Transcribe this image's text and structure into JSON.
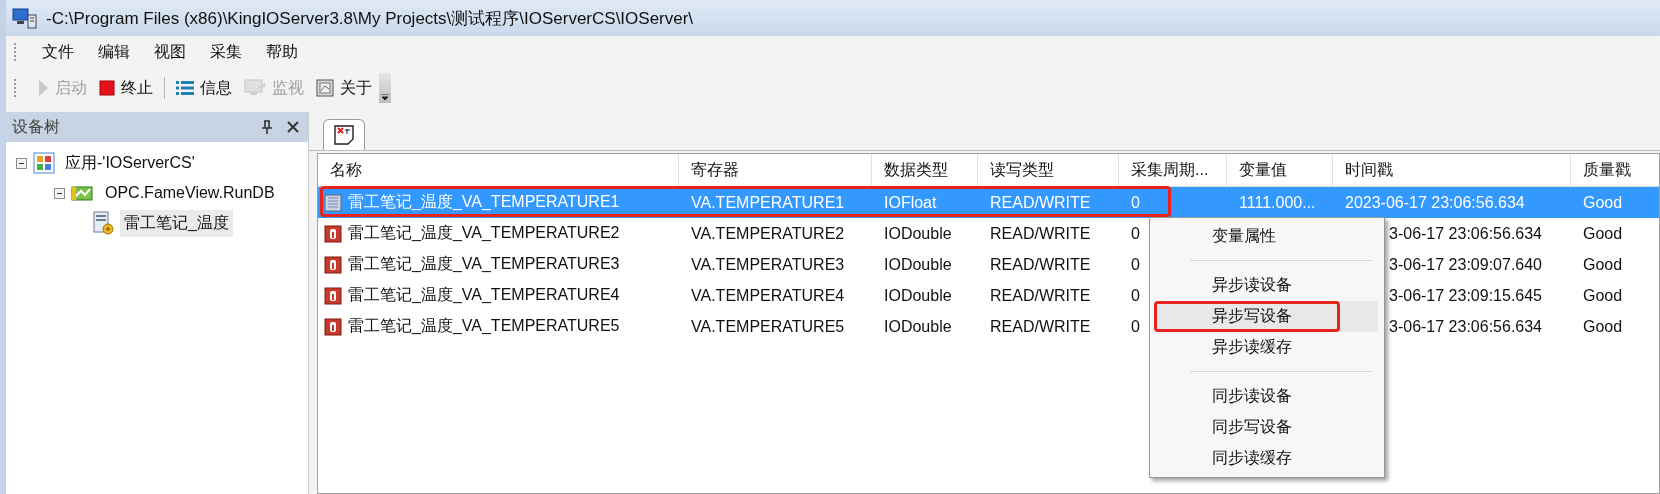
{
  "window": {
    "title": "-C:\\Program Files (x86)\\KingIOServer3.8\\My Projects\\测试程序\\IOServerCS\\IOServer\\"
  },
  "menu_bar": [
    "文件",
    "编辑",
    "视图",
    "采集",
    "帮助"
  ],
  "toolbar": [
    {
      "kind": "play",
      "label": "启动",
      "disabled": true
    },
    {
      "kind": "stop",
      "label": "终止",
      "disabled": false
    },
    {
      "kind": "separator"
    },
    {
      "kind": "list",
      "label": "信息",
      "disabled": false
    },
    {
      "kind": "monitor",
      "label": "监视",
      "disabled": true
    },
    {
      "kind": "about",
      "label": "关于",
      "disabled": false
    },
    {
      "kind": "overflow"
    }
  ],
  "device_tree": {
    "title": "设备树",
    "items": [
      {
        "label": "应用-'IOServerCS'",
        "kind": "app",
        "expanded": true,
        "selected": false,
        "children": [
          {
            "label": "OPC.FameView.RunDB",
            "kind": "driver",
            "expanded": true,
            "selected": false,
            "children": [
              {
                "label": "雷工笔记_温度",
                "kind": "device",
                "selected": true
              }
            ]
          }
        ]
      }
    ]
  },
  "table": {
    "columns": [
      "名称",
      "寄存器",
      "数据类型",
      "读写类型",
      "采集周期...",
      "变量值",
      "时间戳",
      "质量戳"
    ],
    "rows": [
      {
        "name": "雷工笔记_温度_VA_TEMPERATURE1",
        "register": "VA.TEMPERATURE1",
        "data_type": "IOFloat",
        "access": "READ/WRITE",
        "period": "0",
        "value": "1111.000...",
        "timestamp": "2023-06-17 23:06:56.634",
        "timestamp_covered": false,
        "quality": "Good",
        "selected": true,
        "annotated": true
      },
      {
        "name": "雷工笔记_温度_VA_TEMPERATURE2",
        "register": "VA.TEMPERATURE2",
        "data_type": "IODouble",
        "access": "READ/WRITE",
        "period": "0",
        "timestamp": "3-06-17 23:06:56.634",
        "timestamp_covered": true,
        "quality": "Good",
        "selected": false,
        "annotated": false
      },
      {
        "name": "雷工笔记_温度_VA_TEMPERATURE3",
        "register": "VA.TEMPERATURE3",
        "data_type": "IODouble",
        "access": "READ/WRITE",
        "period": "0",
        "timestamp": "3-06-17 23:09:07.640",
        "timestamp_covered": true,
        "quality": "Good",
        "selected": false,
        "annotated": false
      },
      {
        "name": "雷工笔记_温度_VA_TEMPERATURE4",
        "register": "VA.TEMPERATURE4",
        "data_type": "IODouble",
        "access": "READ/WRITE",
        "period": "0",
        "timestamp": "3-06-17 23:09:15.645",
        "timestamp_covered": true,
        "quality": "Good",
        "selected": false,
        "annotated": false
      },
      {
        "name": "雷工笔记_温度_VA_TEMPERATURE5",
        "register": "VA.TEMPERATURE5",
        "data_type": "IODouble",
        "access": "READ/WRITE",
        "period": "0",
        "timestamp": "3-06-17 23:06:56.634",
        "timestamp_covered": true,
        "quality": "Good",
        "selected": false,
        "annotated": false
      }
    ]
  },
  "context_menu": {
    "items": [
      {
        "kind": "item",
        "label": "变量属性",
        "highlighted": false,
        "annotated": false
      },
      {
        "kind": "separator"
      },
      {
        "kind": "item",
        "label": "异步读设备",
        "highlighted": false,
        "annotated": false
      },
      {
        "kind": "item",
        "label": "异步写设备",
        "highlighted": true,
        "annotated": true
      },
      {
        "kind": "item",
        "label": "异步读缓存",
        "highlighted": false,
        "annotated": false
      },
      {
        "kind": "separator"
      },
      {
        "kind": "item",
        "label": "同步读设备",
        "highlighted": false,
        "annotated": false
      },
      {
        "kind": "item",
        "label": "同步写设备",
        "highlighted": false,
        "annotated": false
      },
      {
        "kind": "item",
        "label": "同步读缓存",
        "highlighted": false,
        "annotated": false
      }
    ]
  }
}
